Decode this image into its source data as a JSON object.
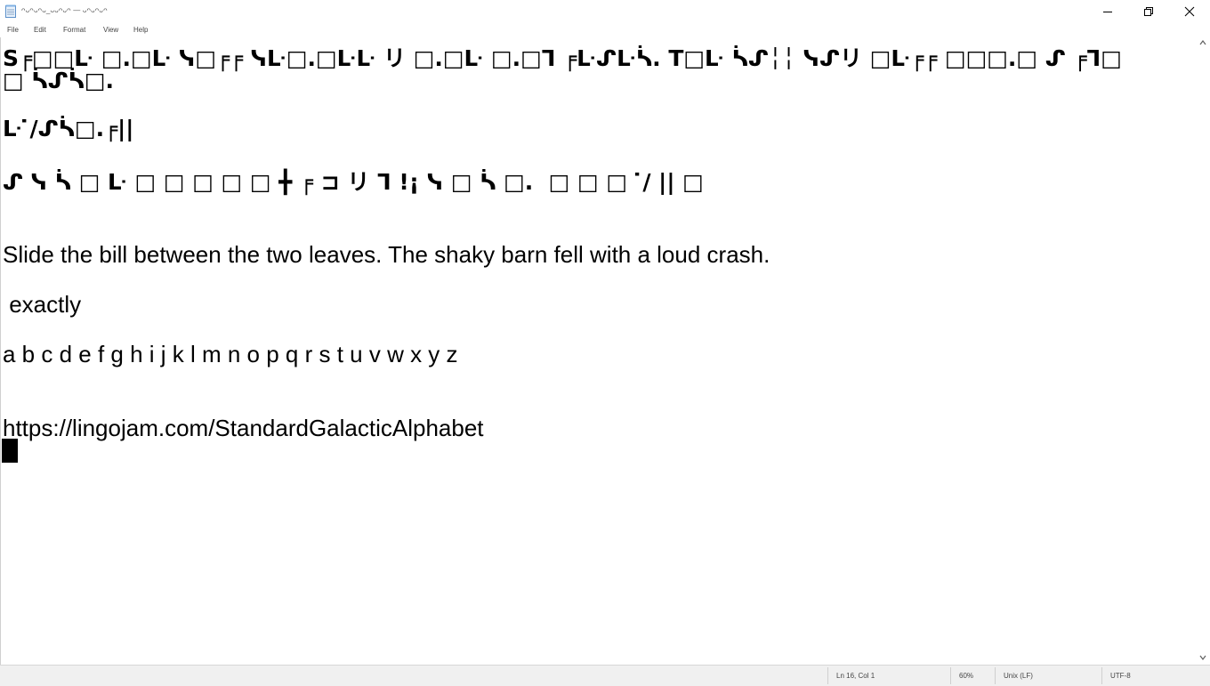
{
  "window": {
    "title": "Notepad window title",
    "title_display": "ᴖᴗᴖᴗᴖᴗ_ᴗᴗᴖᴗᴖ — ᴗᴖᴗᴖᴗᴖ"
  },
  "menu": {
    "file": "File",
    "edit": "Edit",
    "format": "Format",
    "view": "View",
    "help": "Help"
  },
  "editor": {
    "line1": "S╒□□ᒷ □.□ᒷ ᓭ□╒╒ ᓭᒷ□.□ᒷᒷ リ □.□ᒷ □.□ᒣ ╒ᒷᔑᒷᓵ. T□ᒷ ᓵᔑ╎╎ ᓭᔑリ □ᒷ╒╒ □□□.□ ᔑ ╒ᒣ□",
    "line2": "□ ᓵᔑᓵ□.",
    "line3": "ᒷ ̇/ᔑᓵ□.╒||",
    "line4": "ᔑ ᓭ ᓵ □ ᒷ □ □ □ □ □ ╋ ╒ ⊐ リ ᒣ !¡ ᓭ □ ᓵ □.  □ □ □  ̇/ || □",
    "line5": "Slide the bill between the two leaves. The shaky barn fell with a loud crash.",
    "line6": " exactly",
    "line7": "a b c d e f g h i j k l m n o p q r s t u v w x y z",
    "line8": "https://lingojam.com/StandardGalacticAlphabet"
  },
  "status": {
    "position": "Ln 16, Col 1",
    "zoom": "60%",
    "line_ending": "Unix (LF)",
    "encoding": "UTF-8"
  },
  "icons": {
    "app": "notepad-icon",
    "minimize": "minimize-icon",
    "maximize": "restore-icon",
    "close": "close-icon"
  }
}
